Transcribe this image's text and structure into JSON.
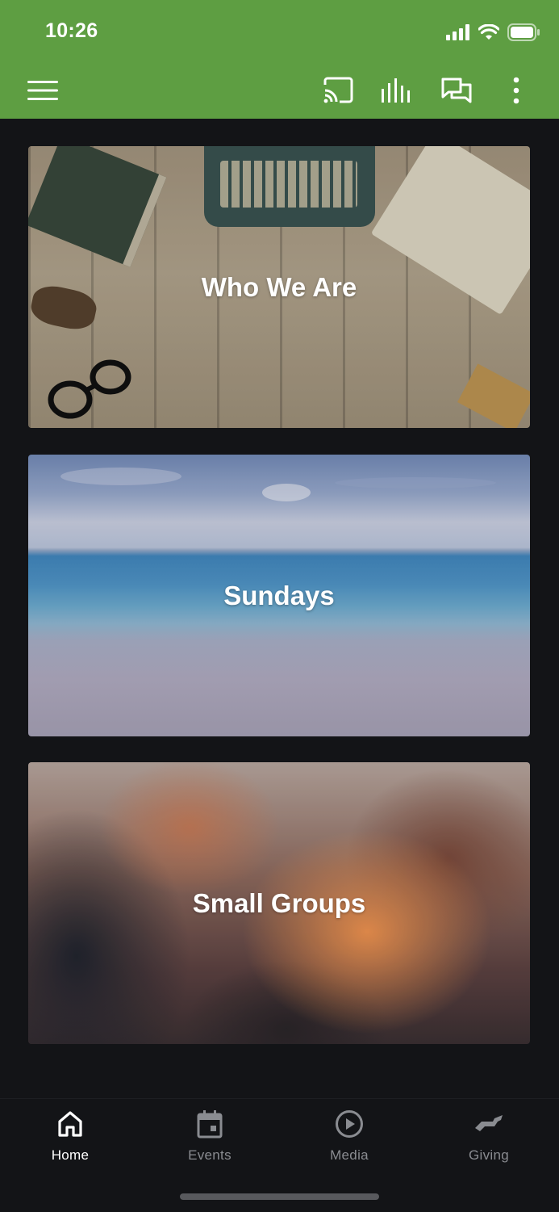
{
  "status_bar": {
    "time": "10:26"
  },
  "toolbar": {
    "icons": [
      "menu-icon",
      "cast-icon",
      "audio-bars-icon",
      "chat-icon",
      "more-vert-icon"
    ],
    "accent_color": "#5e9e42"
  },
  "cards": [
    {
      "title": "Who We Are"
    },
    {
      "title": "Sundays"
    },
    {
      "title": "Small Groups"
    }
  ],
  "tabs": [
    {
      "label": "Home",
      "icon": "home-icon",
      "active": true
    },
    {
      "label": "Events",
      "icon": "calendar-icon",
      "active": false
    },
    {
      "label": "Media",
      "icon": "play-circle-icon",
      "active": false
    },
    {
      "label": "Giving",
      "icon": "giving-hand-icon",
      "active": false
    }
  ]
}
